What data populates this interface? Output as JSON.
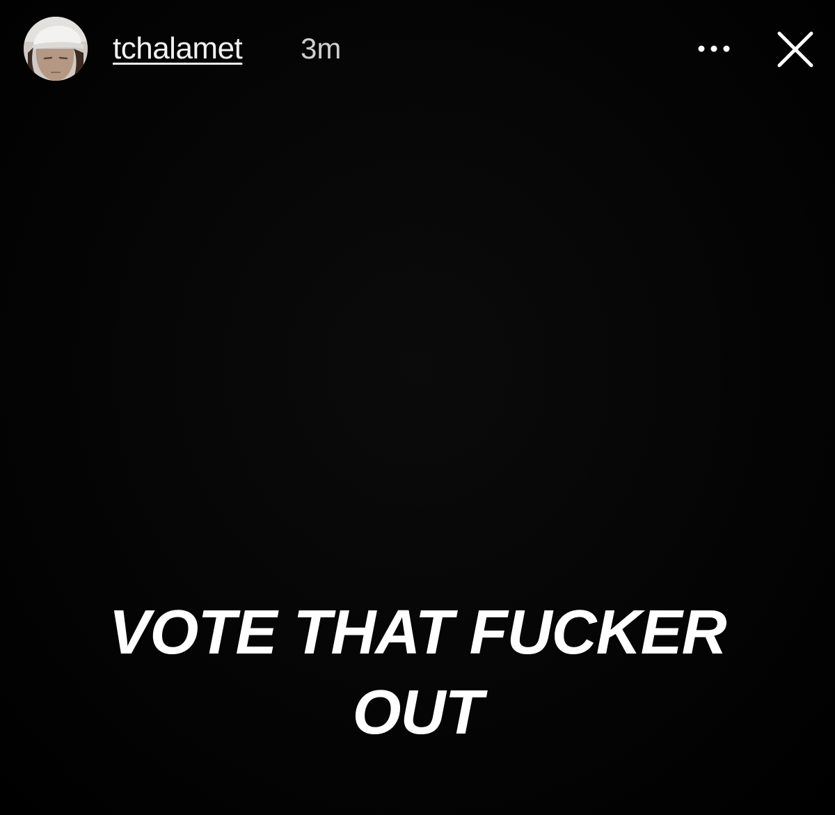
{
  "story": {
    "background_color": "#000000",
    "header": {
      "avatar_icon": "profile-avatar",
      "username": "tchalamet",
      "timestamp": "3m",
      "more_icon": "more-options-icon",
      "close_icon": "close-icon"
    },
    "caption": {
      "lines": [
        "VOTE THAT FUCKER",
        "OUT"
      ],
      "color": "#ffffff"
    }
  }
}
